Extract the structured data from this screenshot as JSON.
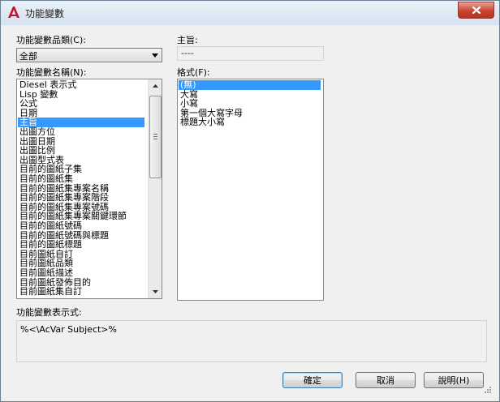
{
  "window": {
    "title": "功能變數"
  },
  "category": {
    "label": "功能變數品類(C):",
    "selected": "全部"
  },
  "names": {
    "label": "功能變數名稱(N):",
    "items": [
      "Diesel 表示式",
      "Lisp 變數",
      "公式",
      "日期",
      "主旨",
      "出圖方位",
      "出圖日期",
      "出圖比例",
      "出圖型式表",
      "目前的圖紙子集",
      "目前的圖紙集",
      "目前的圖紙集專案名稱",
      "目前的圖紙集專案階段",
      "目前的圖紙集專案號碼",
      "目前的圖紙集專案關鍵環節",
      "目前的圖紙號碼",
      "目前的圖紙號碼與標題",
      "目前的圖紙標題",
      "目前圖紙自訂",
      "目前圖紙品類",
      "目前圖紙描述",
      "目前圖紙發佈目的",
      "目前圖紙集自訂"
    ],
    "selected_index": 4
  },
  "subject": {
    "label": "主旨:",
    "value": "----"
  },
  "format": {
    "label": "格式(F):",
    "items": [
      "(無)",
      "大寫",
      "小寫",
      "第一個大寫字母",
      "標題大小寫"
    ],
    "selected_index": 0
  },
  "expression": {
    "label": "功能變數表示式:",
    "value": "%<\\AcVar Subject>%"
  },
  "buttons": {
    "ok": "確定",
    "cancel": "取消",
    "help": "說明(H)"
  },
  "colors": {
    "selection": "#3399ff",
    "title_gradient_top": "#e9f0f8",
    "close_button": "#c9452f"
  }
}
